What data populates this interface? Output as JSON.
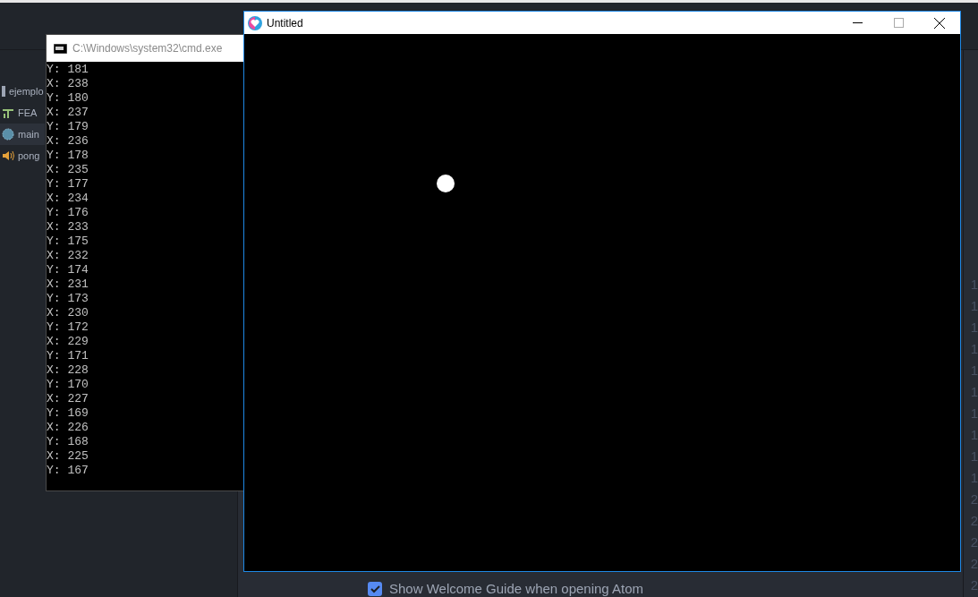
{
  "sidebar": {
    "items": [
      {
        "label": "ejemplo",
        "kind": "folder",
        "selected": false
      },
      {
        "label": "FEA",
        "kind": "font",
        "selected": false
      },
      {
        "label": "main",
        "kind": "code",
        "selected": true
      },
      {
        "label": "pong",
        "kind": "audio",
        "selected": false
      }
    ]
  },
  "gutter": {
    "line_numbers": [
      "1",
      "1",
      "1",
      "1",
      "1",
      "1",
      "1",
      "1",
      "1",
      "1",
      "2",
      "2",
      "2",
      "2",
      "2"
    ]
  },
  "welcome": {
    "checkbox": {
      "label": "Show Welcome Guide when opening Atom",
      "checked": true
    }
  },
  "console_window": {
    "title": "C:\\Windows\\system32\\cmd.exe",
    "lines": [
      "Y: 181",
      "X: 238",
      "Y: 180",
      "X: 237",
      "Y: 179",
      "X: 236",
      "Y: 178",
      "X: 235",
      "Y: 177",
      "X: 234",
      "Y: 176",
      "X: 233",
      "Y: 175",
      "X: 232",
      "Y: 174",
      "X: 231",
      "Y: 173",
      "X: 230",
      "Y: 172",
      "X: 229",
      "Y: 171",
      "X: 228",
      "Y: 170",
      "X: 227",
      "Y: 169",
      "X: 226",
      "Y: 168",
      "X: 225",
      "Y: 167"
    ]
  },
  "game_window": {
    "title": "Untitled"
  }
}
